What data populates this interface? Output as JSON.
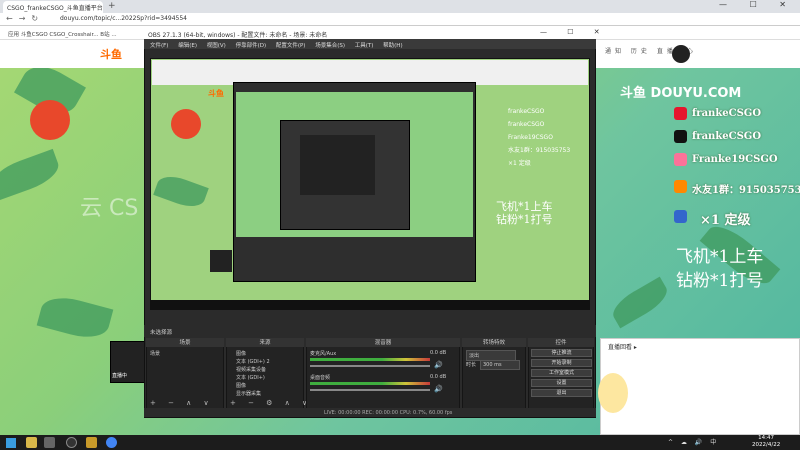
{
  "browser": {
    "tab_title": "CSGO_frankeCSGO_斗鱼直播平台",
    "url": "douyu.com/topic/c...2022Sp?rid=3494554",
    "bookmarks": "应用  斗鱼CSGO  CSGO_Crosshair...  B站  ...",
    "win_controls": "—  ☐  ✕"
  },
  "site": {
    "logo": "斗鱼",
    "header_icons": "通知  历史  直播中心"
  },
  "overlay": {
    "douyu_logo": "斗鱼 DOUYU.COM",
    "social": [
      {
        "icon": "weibo-icon",
        "text": "frankeCSGO",
        "color": "#e6162d"
      },
      {
        "icon": "douyin-icon",
        "text": "frankeCSGO",
        "color": "#111111"
      },
      {
        "icon": "bilibili-icon",
        "text": "Franke19CSGO",
        "color": "#fb7299"
      },
      {
        "icon": "fan-group-icon",
        "text": "水友1群：915035753",
        "color": "#ff8800"
      },
      {
        "icon": "rocket-icon",
        "text": "×1 定级",
        "color": "#3366cc"
      }
    ],
    "line1": "飞机*1上车",
    "line2": "钻粉*1打号"
  },
  "obs": {
    "title": "OBS 27.1.3 (64-bit, windows) - 配置文件: 未命名 - 场景: 未命名",
    "menu": [
      "文件(F)",
      "编辑(E)",
      "视图(V)",
      "停靠部件(D)",
      "配置文件(P)",
      "场景集合(S)",
      "工具(T)",
      "帮助(H)"
    ],
    "scene_bar": "未选择源",
    "docks": {
      "scenes": "场景",
      "sources": "来源",
      "mixer": "混音器",
      "transitions": "转场特效",
      "controls": "控件"
    },
    "scene_items": [
      "场景"
    ],
    "source_items": [
      "图像",
      "文本 (GDI+) 2",
      "视频采集设备",
      "文本 (GDI+)",
      "图像",
      "显示器采集"
    ],
    "mixer": [
      {
        "name": "麦克风/Aux",
        "db": "0.0 dB"
      },
      {
        "name": "桌面音频",
        "db": "0.0 dB"
      }
    ],
    "transition": {
      "type": "淡出",
      "duration_label": "时长",
      "duration": "300 ms"
    },
    "controls": [
      "停止推流",
      "开始录制",
      "工作室模式",
      "设置",
      "退出"
    ],
    "status": "LIVE: 00:00:00   REC: 00:00:00   CPU: 0.7%, 60.00 fps"
  },
  "page": {
    "bg_text": "云 CS",
    "cam_label": "直播中",
    "chat_tab": "直播回看 ▸"
  },
  "taskbar": {
    "tray": "^ ☁ 🔊 中",
    "time": "14:47",
    "date": "2022/4/22"
  }
}
